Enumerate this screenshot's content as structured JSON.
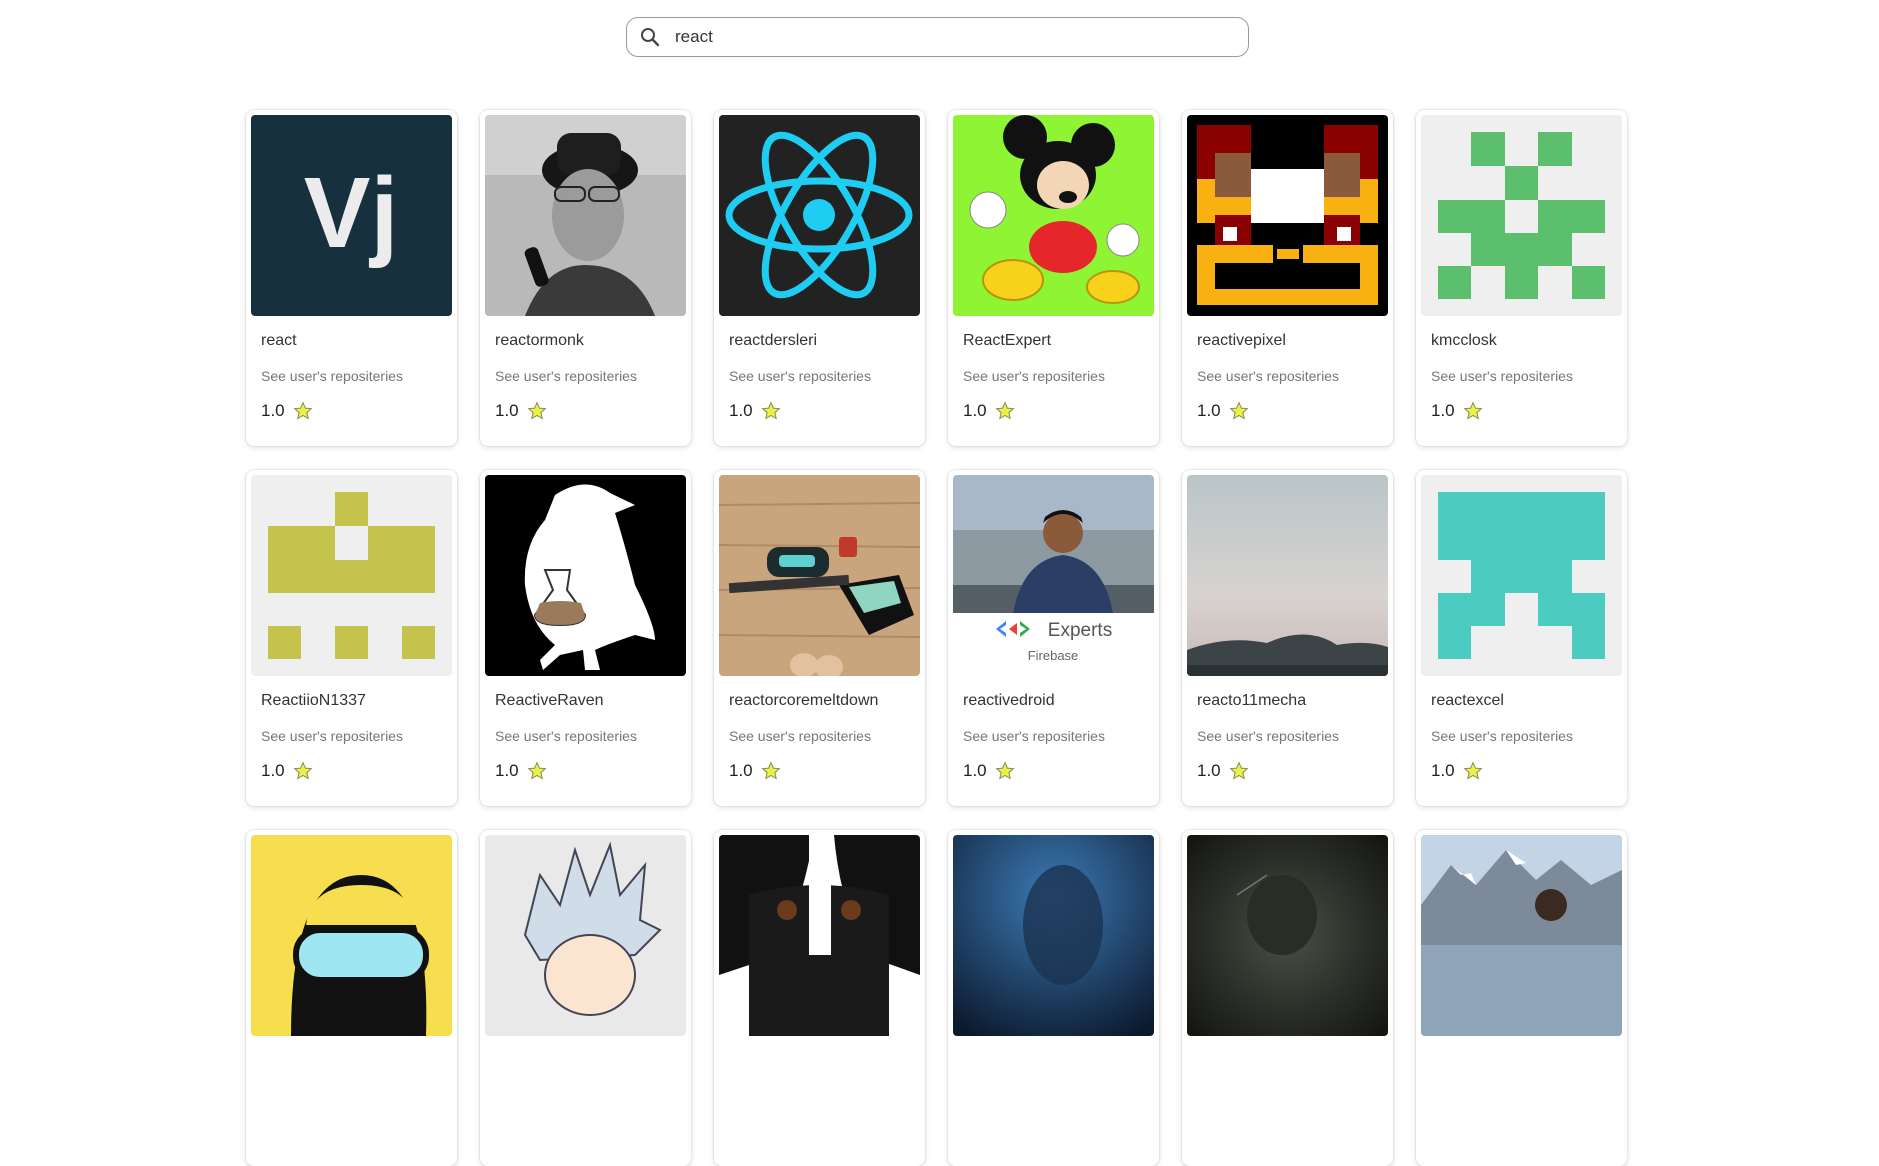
{
  "search": {
    "value": "react",
    "placeholder": ""
  },
  "cards": [
    {
      "username": "react",
      "repos_link": "See user's repositeries",
      "rating": "1.0"
    },
    {
      "username": "reactormonk",
      "repos_link": "See user's repositeries",
      "rating": "1.0"
    },
    {
      "username": "reactdersleri",
      "repos_link": "See user's repositeries",
      "rating": "1.0"
    },
    {
      "username": "ReactExpert",
      "repos_link": "See user's repositeries",
      "rating": "1.0"
    },
    {
      "username": "reactivepixel",
      "repos_link": "See user's repositeries",
      "rating": "1.0"
    },
    {
      "username": "kmcclosk",
      "repos_link": "See user's repositeries",
      "rating": "1.0"
    },
    {
      "username": "ReactiioN1337",
      "repos_link": "See user's repositeries",
      "rating": "1.0"
    },
    {
      "username": "ReactiveRaven",
      "repos_link": "See user's repositeries",
      "rating": "1.0"
    },
    {
      "username": "reactorcoremeltdown",
      "repos_link": "See user's repositeries",
      "rating": "1.0"
    },
    {
      "username": "reactivedroid",
      "repos_link": "See user's repositeries",
      "rating": "1.0"
    },
    {
      "username": "reacto11mecha",
      "repos_link": "See user's repositeries",
      "rating": "1.0"
    },
    {
      "username": "reactexcel",
      "repos_link": "See user's repositeries",
      "rating": "1.0"
    },
    {
      "username": "",
      "repos_link": "",
      "rating": ""
    },
    {
      "username": "",
      "repos_link": "",
      "rating": ""
    },
    {
      "username": "",
      "repos_link": "",
      "rating": ""
    },
    {
      "username": "",
      "repos_link": "",
      "rating": ""
    },
    {
      "username": "",
      "repos_link": "",
      "rating": ""
    },
    {
      "username": "",
      "repos_link": "",
      "rating": ""
    }
  ],
  "avatar_text": {
    "vj_logo": "Vj",
    "experts_word": "Experts",
    "firebase_word": "Firebase"
  },
  "colors": {
    "star": "#e8f24a",
    "identicon_green": "#5cbf6e",
    "identicon_olive": "#c4c44c",
    "identicon_teal": "#4ccbc0",
    "react_blue": "#1fcdf2"
  }
}
